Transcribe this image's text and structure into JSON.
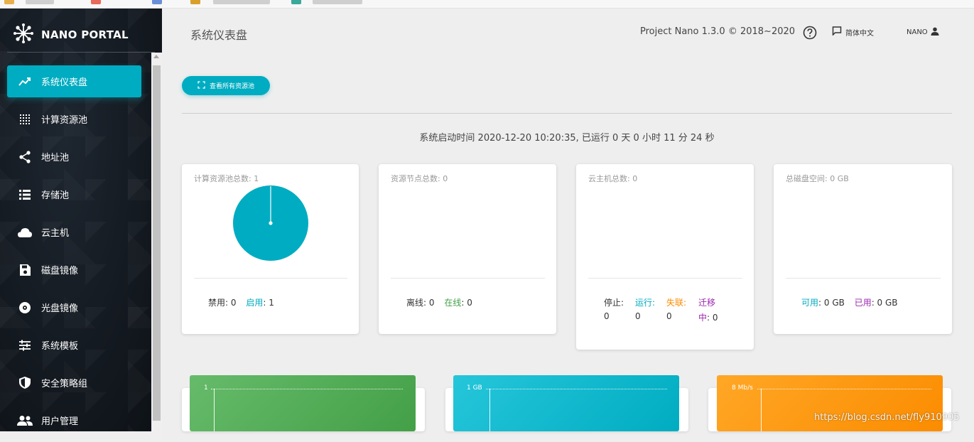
{
  "brand": {
    "name": "NANO PORTAL"
  },
  "nav": {
    "items": [
      {
        "label": "系统仪表盘",
        "icon": "dashboard-icon",
        "active": true
      },
      {
        "label": "计算资源池",
        "icon": "grid-icon",
        "active": false
      },
      {
        "label": "地址池",
        "icon": "share-icon",
        "active": false
      },
      {
        "label": "存储池",
        "icon": "list-icon",
        "active": false
      },
      {
        "label": "云主机",
        "icon": "cloud-icon",
        "active": false
      },
      {
        "label": "磁盘镜像",
        "icon": "save-icon",
        "active": false
      },
      {
        "label": "光盘镜像",
        "icon": "disc-icon",
        "active": false
      },
      {
        "label": "系统模板",
        "icon": "sliders-icon",
        "active": false
      },
      {
        "label": "安全策略组",
        "icon": "shield-icon",
        "active": false
      },
      {
        "label": "用户管理",
        "icon": "users-icon",
        "active": false
      }
    ]
  },
  "header": {
    "title": "系统仪表盘",
    "version": "Project Nano 1.3.0 © 2018~2020",
    "language": "简体中文",
    "user": "NANO"
  },
  "toolbar": {
    "pool_button": "查看所有资源池"
  },
  "uptime": "系统启动时间 2020-12-20 10:20:35, 已运行 0 天 0 小时 11 分 24 秒",
  "cards": {
    "compute": {
      "title": "计算资源池总数: 1",
      "disabled_label": "禁用",
      "disabled_value": ": 0",
      "enabled_label": "启用",
      "enabled_value": ": 1"
    },
    "nodes": {
      "title": "资源节点总数: 0",
      "offline_label": "离线",
      "offline_value": ": 0",
      "online_label": "在线",
      "online_value": ": 0"
    },
    "vms": {
      "title": "云主机总数: 0",
      "stopped_label": "停止:",
      "stopped_value": "0",
      "running_label": "运行:",
      "running_value": "0",
      "lost_label": "失联:",
      "lost_value": "0",
      "migrating_label_1": "迁移",
      "migrating_label_2": "中",
      "migrating_value": ": 0"
    },
    "disk": {
      "title": "总磁盘空间: 0 GB",
      "available_label": "可用",
      "available_value": ": 0 GB",
      "used_label": "已用",
      "used_value": ": 0 GB"
    }
  },
  "charts": [
    {
      "label": "1",
      "color": "#4caf50"
    },
    {
      "label": "1 GB",
      "color": "#00bcd4"
    },
    {
      "label": "8 Mb/s",
      "color": "#ff9800"
    }
  ],
  "colors": {
    "accent": "#00acc1",
    "green": "#43a047",
    "orange": "#fb8c00",
    "purple": "#9c27b0"
  },
  "watermark": "https://blog.csdn.net/fly910905"
}
